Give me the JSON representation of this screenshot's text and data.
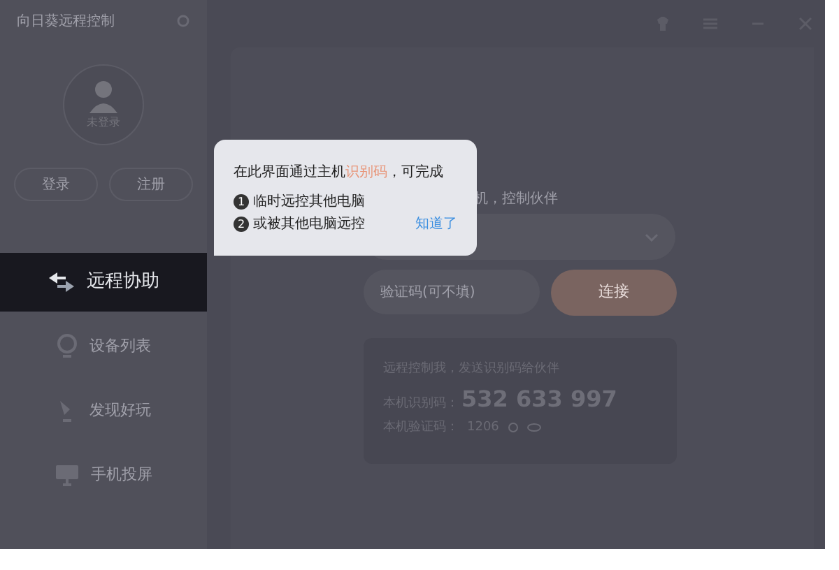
{
  "window": {
    "title": "向日葵远程控制"
  },
  "user": {
    "status": "未登录"
  },
  "auth_buttons": [
    "登录",
    "注册"
  ],
  "nav": [
    {
      "label": "远程协助",
      "selected": true,
      "kind": "arrows"
    },
    {
      "label": "设备列表",
      "selected": false,
      "kind": "pin"
    },
    {
      "label": "发现好玩",
      "selected": false,
      "kind": "bulb"
    },
    {
      "label": "手机投屏",
      "selected": false,
      "kind": "monitor"
    }
  ],
  "tooltip": {
    "before": "在此界面通过主机",
    "highlight": "识别码",
    "after": "，可完成",
    "items": [
      {
        "marker": "1",
        "text": "临时远控其他电脑"
      },
      {
        "marker": "2",
        "text": "或被其他电脑远控"
      }
    ],
    "dismiss": "知道了"
  },
  "main": {
    "hint": "机，控制伙伴",
    "verify_placeholder": "验证码(可不填)",
    "connect": "连接",
    "card": {
      "heading": "远程控制我，发送识别码给伙伴",
      "id_label": "本机识别码：",
      "id_value": "532 633 997",
      "code_label": "本机验证码：",
      "code_value": "1206"
    }
  }
}
